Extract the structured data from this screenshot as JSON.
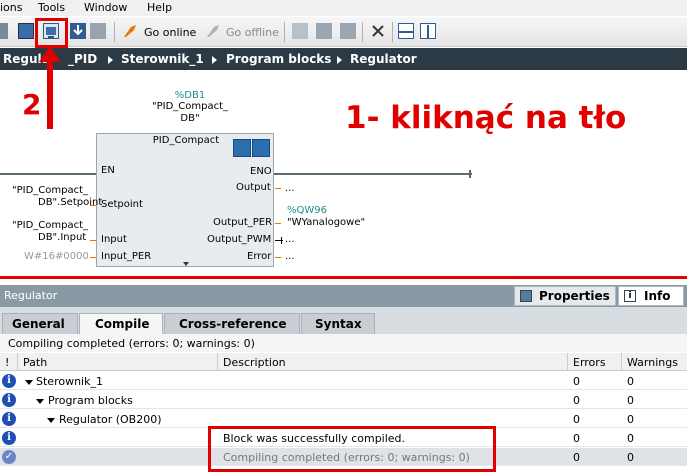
{
  "menu": {
    "items": [
      "ions",
      "Tools",
      "Window",
      "Help"
    ]
  },
  "toolbar": {
    "go_online": "Go online",
    "go_offline": "Go offline"
  },
  "breadcrumb": {
    "items": [
      "Regula",
      "_PID",
      "Sterownik_1",
      "Program blocks",
      "Regulator"
    ]
  },
  "annotations": {
    "step2": "2",
    "step1": "1- kliknąć na tło"
  },
  "block": {
    "db_address": "%DB1",
    "db_name_l1": "\"PID_Compact_",
    "db_name_l2": "DB\"",
    "type": "PID_Compact",
    "inputs": {
      "en": "EN",
      "setpoint": "Setpoint",
      "input": "Input",
      "input_per": "Input_PER"
    },
    "outputs": {
      "eno": "ENO",
      "output": "Output",
      "output_per": "Output_PER",
      "output_pwm": "Output_PWM",
      "error": "Error"
    },
    "operands": {
      "setpoint_l1": "\"PID_Compact_",
      "setpoint_l2": "DB\".Setpoint",
      "input_l1": "\"PID_Compact_",
      "input_l2": "DB\".Input",
      "input_per": "W#16#0000",
      "output": "...",
      "output_per_addr": "%QW96",
      "output_per_name": "\"WYanalogowe\"",
      "output_pwm": "...",
      "error": "..."
    }
  },
  "panel": {
    "title": "Regulator",
    "properties_tab": "Properties",
    "info_tab": "Info",
    "tabs": [
      "General",
      "Compile",
      "Cross-reference",
      "Syntax"
    ],
    "status": "Compiling completed (errors: 0; warnings: 0)",
    "columns": {
      "flag": "!",
      "path": "Path",
      "description": "Description",
      "errors": "Errors",
      "warnings": "Warnings"
    },
    "rows": [
      {
        "path": "Sterownik_1",
        "description": "",
        "errors": "0",
        "warnings": "0"
      },
      {
        "path": "Program blocks",
        "description": "",
        "errors": "0",
        "warnings": "0"
      },
      {
        "path": "Regulator (OB200)",
        "description": "",
        "errors": "0",
        "warnings": "0"
      },
      {
        "path": "",
        "description": "Block was successfully compiled.",
        "errors": "0",
        "warnings": "0"
      },
      {
        "path": "",
        "description": "Compiling completed (errors: 0; warnings: 0)",
        "errors": "0",
        "warnings": "0"
      }
    ]
  },
  "colors": {
    "annotation_red": "#e00000",
    "breadcrumb_bg": "#2b3a44",
    "info_blue": "#1f4fb5",
    "teal": "#1c8f8f"
  }
}
